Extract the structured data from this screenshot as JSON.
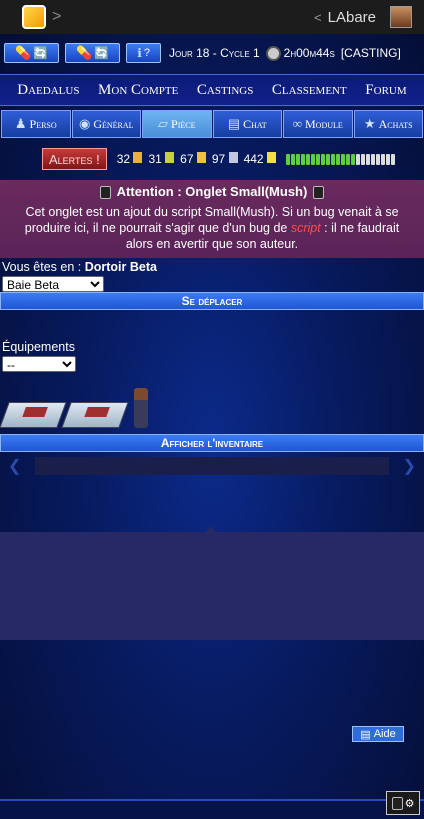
{
  "topbar": {
    "user_name": "LAbare",
    "back_glyph": "<",
    "chevron_glyph": ">"
  },
  "stats": {
    "btn1_pink": "💊",
    "btn1_cy": "🔄",
    "btn2_pink": "💊",
    "btn2_cy": "🔄",
    "btn3_cy": "ℹ",
    "btn3_label": "?",
    "day_cycle": "Jour 18 - Cycle 1",
    "timer": "2h00m44s",
    "casting": "[CASTING]"
  },
  "nav": {
    "items": [
      "Daedalus",
      "Mon Compte",
      "Castings",
      "Classement",
      "Forum"
    ]
  },
  "tabs": [
    {
      "label": "Perso",
      "icon": "person-icon",
      "glyph": "♟"
    },
    {
      "label": "Général",
      "icon": "target-icon",
      "glyph": "◉"
    },
    {
      "label": "Pièce",
      "icon": "room-icon",
      "glyph": "▱"
    },
    {
      "label": "Chat",
      "icon": "book-icon",
      "glyph": "▤"
    },
    {
      "label": "Module",
      "icon": "glasses-icon",
      "glyph": "∞"
    },
    {
      "label": "Achats",
      "icon": "star-icon",
      "glyph": "★"
    }
  ],
  "alerts": {
    "label": "Alertes !",
    "stat1": "32",
    "stat2": "31",
    "stat3": "67",
    "stat4": "97",
    "stat5": "442",
    "crew_green": 14,
    "crew_white": 8
  },
  "warning": {
    "title": "Attention : Onglet Small(Mush)",
    "text_before": "Cet onglet est un ajout du script Small(Mush). Si un bug venait à se produire ici, il ne pourrait s'agir que d'un bug de ",
    "em": "script",
    "text_after": " : il ne faudrait alors en avertir que son auteur."
  },
  "location": {
    "prefix": "Vous êtes en :",
    "room": "Dortoir Beta",
    "select_value": "Baie Beta"
  },
  "move_button": "Se déplacer",
  "equipment": {
    "label": "Équipements",
    "select_value": "--"
  },
  "inventory_button": "Afficher l'inventaire",
  "help": {
    "label": "Aide"
  },
  "colors": {
    "accent": "#2e6cd8",
    "warning_bg": "#6a2a5e",
    "alert_red": "#c83a3a"
  }
}
